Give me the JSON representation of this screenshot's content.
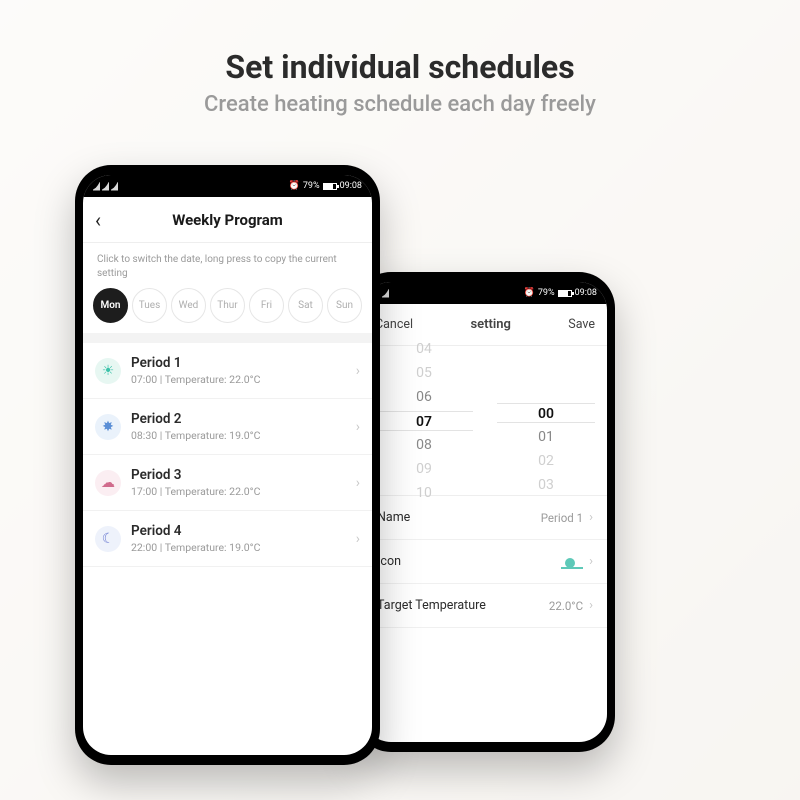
{
  "headline": {
    "title": "Set individual schedules",
    "subtitle": "Create heating schedule each day freely"
  },
  "status_bar": {
    "battery_pct": "79%",
    "time": "09:08"
  },
  "weekly": {
    "title": "Weekly Program",
    "hint": "Click to switch the date, long press to copy the current setting",
    "days": [
      "Mon",
      "Tues",
      "Wed",
      "Thur",
      "Fri",
      "Sat",
      "Sun"
    ],
    "selected_day_index": 0,
    "periods": [
      {
        "name": "Period 1",
        "time": "07:00",
        "temp": "22.0°C",
        "icon": "sunrise",
        "bg": "#e7f7f2",
        "fg": "#3cc2a9"
      },
      {
        "name": "Period 2",
        "time": "08:30",
        "temp": "19.0°C",
        "icon": "sun",
        "bg": "#eaf2fb",
        "fg": "#5b8fd6"
      },
      {
        "name": "Period 3",
        "time": "17:00",
        "temp": "22.0°C",
        "icon": "sunset",
        "bg": "#fbeef2",
        "fg": "#d06b8c"
      },
      {
        "name": "Period 4",
        "time": "22:00",
        "temp": "19.0°C",
        "icon": "moon",
        "bg": "#eef2fb",
        "fg": "#6c7bd1"
      }
    ]
  },
  "setting": {
    "cancel": "Cancel",
    "title": "setting",
    "save": "Save",
    "hours_col": [
      "04",
      "05",
      "06",
      "07",
      "08",
      "09",
      "10"
    ],
    "mins_col": [
      "",
      "",
      "",
      "00",
      "01",
      "02",
      "03"
    ],
    "selected_hour_index": 3,
    "selected_min_index": 3,
    "rows": {
      "name_label": "Name",
      "name_value": "Period 1",
      "icon_label": "Icon",
      "temp_label": "Target Temperature",
      "temp_value": "22.0°C"
    }
  }
}
